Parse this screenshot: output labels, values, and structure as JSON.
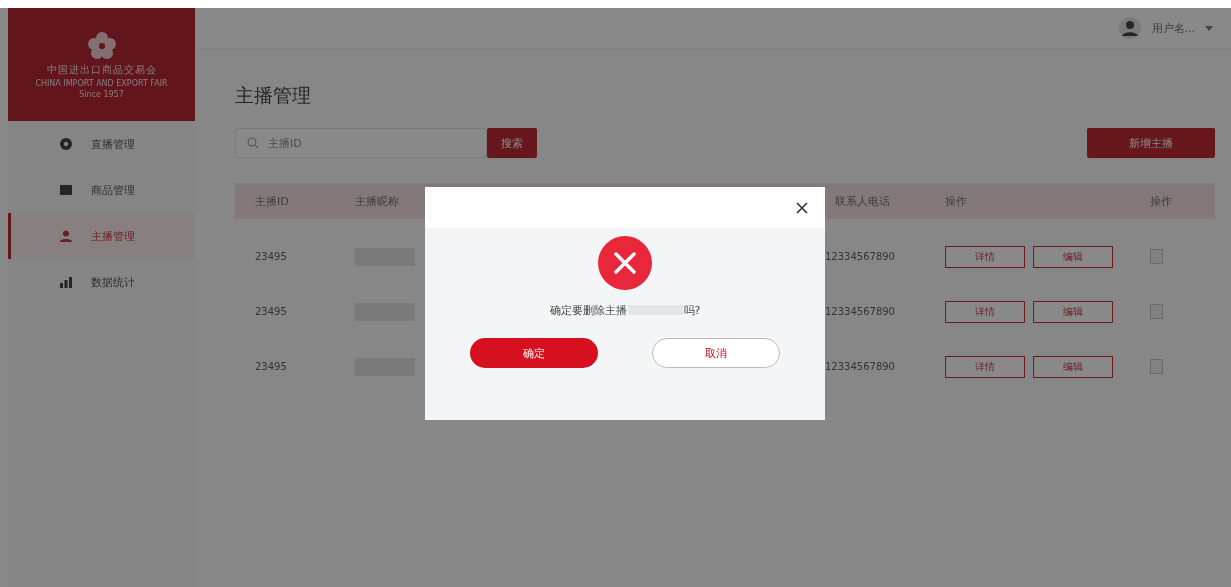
{
  "logo": {
    "title": "中国进出口商品交易会",
    "subtitle": "CHINA IMPORT AND EXPORT FAIR",
    "since": "Since 1957"
  },
  "sidebar": {
    "items": [
      {
        "label": "直播管理",
        "kind": "live",
        "selected": false
      },
      {
        "label": "商品管理",
        "kind": "goods",
        "selected": false
      },
      {
        "label": "主播管理",
        "kind": "anchor",
        "selected": true
      },
      {
        "label": "数据统计",
        "kind": "stats",
        "selected": false
      }
    ]
  },
  "header": {
    "user": "用户名..."
  },
  "page": {
    "title": "主播管理",
    "search": {
      "placeholder": "主播ID"
    },
    "search_button": "搜索",
    "add_button": "新增主播"
  },
  "table": {
    "columns": [
      "主播ID",
      "主播昵称",
      "联系人电话",
      "操作",
      "操作"
    ],
    "rows": [
      {
        "id": "23495",
        "phone": "12334567890",
        "actions": [
          "详情",
          "编辑"
        ],
        "checked": false
      },
      {
        "id": "23495",
        "phone": "12334567890",
        "actions": [
          "详情",
          "编辑"
        ],
        "checked": false
      },
      {
        "id": "23495",
        "phone": "12334567890",
        "actions": [
          "详情",
          "编辑"
        ],
        "checked": false
      }
    ]
  },
  "dialog": {
    "message_before": "确定要删除主播",
    "message_after": "吗?",
    "confirm": "确定",
    "cancel": "取消"
  }
}
